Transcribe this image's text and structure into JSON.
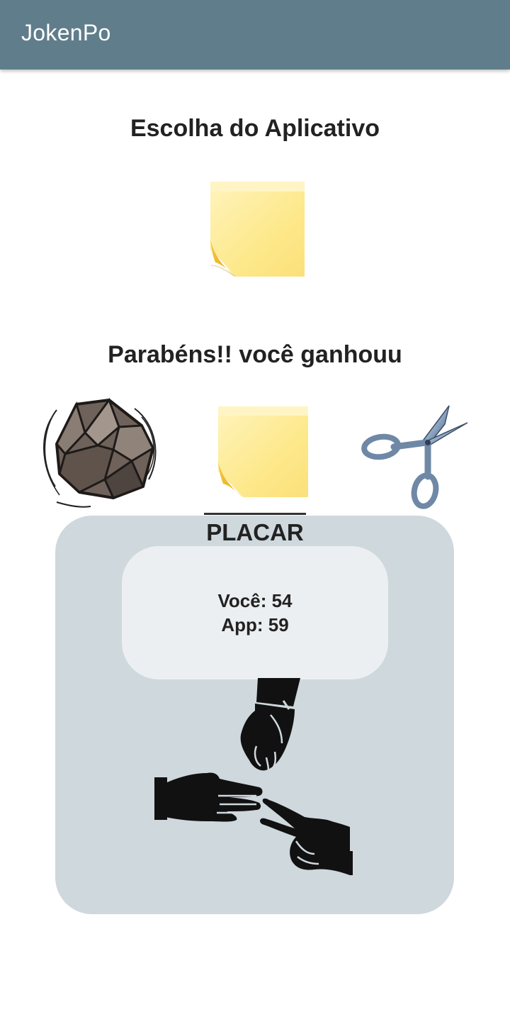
{
  "appbar": {
    "title": "JokenPo",
    "color": "#607d8b"
  },
  "app_choice": {
    "heading": "Escolha do Aplicativo",
    "icon": "paper-note-icon"
  },
  "result": {
    "message": "Parabéns!! você ganhouu"
  },
  "choices": [
    {
      "icon": "rock-icon"
    },
    {
      "icon": "paper-note-icon"
    },
    {
      "icon": "scissors-icon"
    }
  ],
  "scoreboard": {
    "title": "PLACAR",
    "you_label": "Você: 54",
    "app_label": "App: 59",
    "panel_color": "#cfd8dc",
    "card_color": "#eceff1",
    "illustration": "rock-paper-scissors-hands-icon"
  }
}
